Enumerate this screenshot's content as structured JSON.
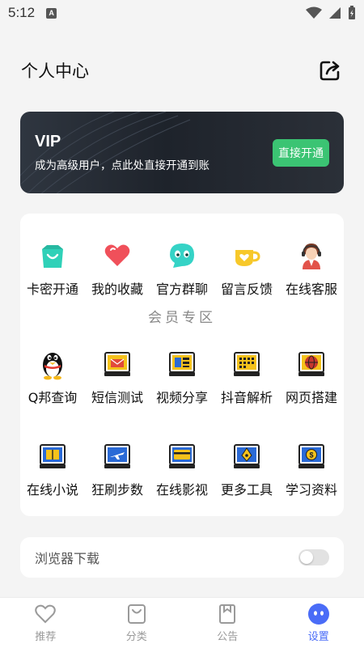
{
  "status_bar": {
    "time": "5:12",
    "notif_glyph": "A"
  },
  "header": {
    "title": "个人中心",
    "share_icon": "share-icon"
  },
  "vip": {
    "title": "VIP",
    "description": "成为高级用户，点此处直接开通到账",
    "button_label": "直接开通"
  },
  "quick_actions": [
    {
      "label": "卡密开通",
      "icon": "shopping-bag-icon"
    },
    {
      "label": "我的收藏",
      "icon": "heart-icon"
    },
    {
      "label": "官方群聊",
      "icon": "chat-face-icon"
    },
    {
      "label": "留言反馈",
      "icon": "cup-icon"
    },
    {
      "label": "在线客服",
      "icon": "support-agent-icon"
    }
  ],
  "member_section": {
    "title": "会员专区",
    "row1": [
      {
        "label": "Q邦查询",
        "icon": "penguin-icon"
      },
      {
        "label": "短信测试",
        "icon": "mail-tablet-icon"
      },
      {
        "label": "视频分享",
        "icon": "video-tablet-icon"
      },
      {
        "label": "抖音解析",
        "icon": "calendar-tablet-icon"
      },
      {
        "label": "网页搭建",
        "icon": "globe-tablet-icon"
      }
    ],
    "row2": [
      {
        "label": "在线小说",
        "icon": "book-tablet-icon"
      },
      {
        "label": "狂刷步数",
        "icon": "plane-tablet-icon"
      },
      {
        "label": "在线影视",
        "icon": "card-tablet-icon"
      },
      {
        "label": "更多工具",
        "icon": "pen-tablet-icon"
      },
      {
        "label": "学习资料",
        "icon": "coin-tablet-icon"
      }
    ]
  },
  "browser_download": {
    "label": "浏览器下载",
    "enabled": false
  },
  "tabbar": [
    {
      "label": "推荐",
      "icon": "heart-outline-icon",
      "active": false
    },
    {
      "label": "分类",
      "icon": "bag-outline-icon",
      "active": false
    },
    {
      "label": "公告",
      "icon": "bookmark-outline-icon",
      "active": false
    },
    {
      "label": "设置",
      "icon": "face-filled-icon",
      "active": true
    }
  ],
  "colors": {
    "accent": "#4a6cf7",
    "vip_button": "#3bc473",
    "vip_card": "#1e232b"
  }
}
